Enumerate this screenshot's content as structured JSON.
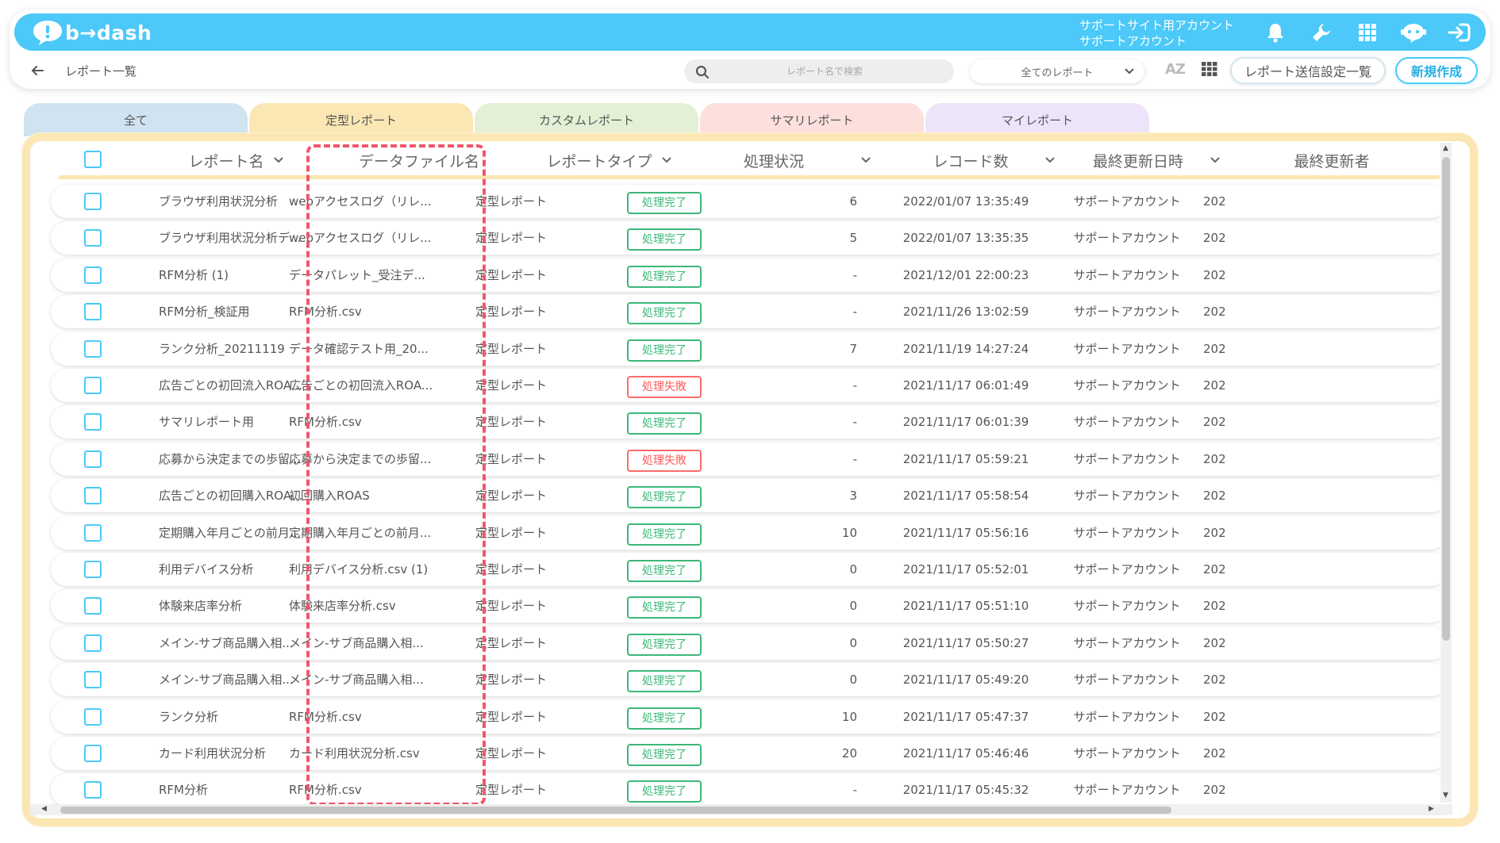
{
  "header": {
    "logo_text": "b→dash",
    "account_line1": "サポートサイト用アカウント",
    "account_line2": "サポートアカウント",
    "icons": [
      "bell-icon",
      "wrench-icon",
      "apps-grid-icon",
      "chat-bot-icon",
      "logout-icon"
    ]
  },
  "subbar": {
    "title": "レポート一覧",
    "search_placeholder": "レポート名で検索",
    "filter_selected": "全てのレポート",
    "az_label": "AZ",
    "send_settings_label": "レポート送信設定一覧",
    "new_label": "新規作成"
  },
  "tabs": [
    {
      "label": "全て",
      "color": "#cfe3f0"
    },
    {
      "label": "定型レポート",
      "color": "#fbe7b3"
    },
    {
      "label": "カスタムレポート",
      "color": "#e4f0d6"
    },
    {
      "label": "サマリレポート",
      "color": "#fde0dd"
    },
    {
      "label": "マイレポート",
      "color": "#eee4f9"
    }
  ],
  "table": {
    "columns": {
      "name": "レポート名",
      "file": "データファイル名",
      "type": "レポートタイプ",
      "status": "処理状況",
      "records": "レコード数",
      "updated_at": "最終更新日時",
      "updated_by": "最終更新者"
    },
    "rows": [
      {
        "name": "ブラウザ利用状況分析",
        "file": "webアクセスログ（リレ...",
        "type": "定型レポート",
        "status": "処理完了",
        "ok": true,
        "records": "6",
        "updated_at": "2022/01/07 13:35:49",
        "updated_by": "サポートアカウント",
        "extra": "202"
      },
      {
        "name": "ブラウザ利用状況分析デ...",
        "file": "webアクセスログ（リレ...",
        "type": "定型レポート",
        "status": "処理完了",
        "ok": true,
        "records": "5",
        "updated_at": "2022/01/07 13:35:35",
        "updated_by": "サポートアカウント",
        "extra": "202"
      },
      {
        "name": "RFM分析 (1)",
        "file": "データパレット_受注デ...",
        "type": "定型レポート",
        "status": "処理完了",
        "ok": true,
        "records": "-",
        "updated_at": "2021/12/01 22:00:23",
        "updated_by": "サポートアカウント",
        "extra": "202"
      },
      {
        "name": "RFM分析_検証用",
        "file": "RFM分析.csv",
        "type": "定型レポート",
        "status": "処理完了",
        "ok": true,
        "records": "-",
        "updated_at": "2021/11/26 13:02:59",
        "updated_by": "サポートアカウント",
        "extra": "202"
      },
      {
        "name": "ランク分析_20211119",
        "file": "データ確認テスト用_20...",
        "type": "定型レポート",
        "status": "処理完了",
        "ok": true,
        "records": "7",
        "updated_at": "2021/11/19 14:27:24",
        "updated_by": "サポートアカウント",
        "extra": "202"
      },
      {
        "name": "広告ごとの初回流入ROA...",
        "file": "広告ごとの初回流入ROA...",
        "type": "定型レポート",
        "status": "処理失敗",
        "ok": false,
        "records": "-",
        "updated_at": "2021/11/17 06:01:49",
        "updated_by": "サポートアカウント",
        "extra": "202"
      },
      {
        "name": "サマリレポート用",
        "file": "RFM分析.csv",
        "type": "定型レポート",
        "status": "処理完了",
        "ok": true,
        "records": "-",
        "updated_at": "2021/11/17 06:01:39",
        "updated_by": "サポートアカウント",
        "extra": "202"
      },
      {
        "name": "応募から決定までの歩留...",
        "file": "応募から決定までの歩留...",
        "type": "定型レポート",
        "status": "処理失敗",
        "ok": false,
        "records": "-",
        "updated_at": "2021/11/17 05:59:21",
        "updated_by": "サポートアカウント",
        "extra": "202"
      },
      {
        "name": "広告ごとの初回購入ROA...",
        "file": "初回購入ROAS",
        "type": "定型レポート",
        "status": "処理完了",
        "ok": true,
        "records": "3",
        "updated_at": "2021/11/17 05:58:54",
        "updated_by": "サポートアカウント",
        "extra": "202"
      },
      {
        "name": "定期購入年月ごとの前月...",
        "file": "定期購入年月ごとの前月...",
        "type": "定型レポート",
        "status": "処理完了",
        "ok": true,
        "records": "10",
        "updated_at": "2021/11/17 05:56:16",
        "updated_by": "サポートアカウント",
        "extra": "202"
      },
      {
        "name": "利用デバイス分析",
        "file": "利用デバイス分析.csv (1)",
        "type": "定型レポート",
        "status": "処理完了",
        "ok": true,
        "records": "0",
        "updated_at": "2021/11/17 05:52:01",
        "updated_by": "サポートアカウント",
        "extra": "202"
      },
      {
        "name": "体験来店率分析",
        "file": "体験来店率分析.csv",
        "type": "定型レポート",
        "status": "処理完了",
        "ok": true,
        "records": "0",
        "updated_at": "2021/11/17 05:51:10",
        "updated_by": "サポートアカウント",
        "extra": "202"
      },
      {
        "name": "メイン-サブ商品購入相...",
        "file": "メイン-サブ商品購入相...",
        "type": "定型レポート",
        "status": "処理完了",
        "ok": true,
        "records": "0",
        "updated_at": "2021/11/17 05:50:27",
        "updated_by": "サポートアカウント",
        "extra": "202"
      },
      {
        "name": "メイン-サブ商品購入相...",
        "file": "メイン-サブ商品購入相...",
        "type": "定型レポート",
        "status": "処理完了",
        "ok": true,
        "records": "0",
        "updated_at": "2021/11/17 05:49:20",
        "updated_by": "サポートアカウント",
        "extra": "202"
      },
      {
        "name": "ランク分析",
        "file": "RFM分析.csv",
        "type": "定型レポート",
        "status": "処理完了",
        "ok": true,
        "records": "10",
        "updated_at": "2021/11/17 05:47:37",
        "updated_by": "サポートアカウント",
        "extra": "202"
      },
      {
        "name": "カード利用状況分析",
        "file": "カード利用状況分析.csv",
        "type": "定型レポート",
        "status": "処理完了",
        "ok": true,
        "records": "20",
        "updated_at": "2021/11/17 05:46:46",
        "updated_by": "サポートアカウント",
        "extra": "202"
      },
      {
        "name": "RFM分析",
        "file": "RFM分析.csv",
        "type": "定型レポート",
        "status": "処理完了",
        "ok": true,
        "records": "-",
        "updated_at": "2021/11/17 05:45:32",
        "updated_by": "サポートアカウント",
        "extra": "202"
      }
    ]
  },
  "colors": {
    "brand": "#4cc9f8",
    "ok": "#3cb878",
    "ng": "#ff6b6b",
    "highlight": "#f1576b",
    "panel_border": "#fbe7b3"
  }
}
